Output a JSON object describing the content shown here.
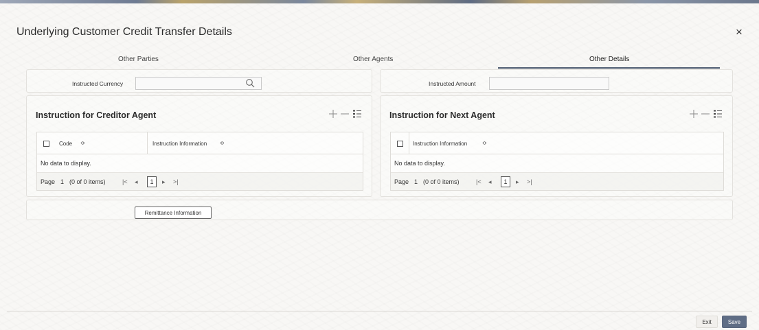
{
  "dialog": {
    "title": "Underlying Customer Credit Transfer Details",
    "close_symbol": "×"
  },
  "tabs": [
    {
      "label": "Other Parties",
      "active": false
    },
    {
      "label": "Other Agents",
      "active": false
    },
    {
      "label": "Other Details",
      "active": true
    }
  ],
  "fields": {
    "instructed_currency_label": "Instructed Currency",
    "instructed_currency_value": "",
    "instructed_amount_label": "Instructed Amount",
    "instructed_amount_value": ""
  },
  "creditor_agent": {
    "title": "Instruction for Creditor Agent",
    "columns": [
      "Code",
      "Instruction Information"
    ],
    "no_data": "No data to display.",
    "pager": {
      "page_label": "Page",
      "page_number": "1",
      "items": "(0 of 0 items)",
      "current": "1"
    }
  },
  "next_agent": {
    "title": "Instruction for Next Agent",
    "columns": [
      "Instruction Information"
    ],
    "no_data": "No data to display.",
    "pager": {
      "page_label": "Page",
      "page_number": "1",
      "items": "(0 of 0 items)",
      "current": "1"
    }
  },
  "buttons": {
    "remittance": "Remittance Information",
    "exit": "Exit",
    "save": "Save"
  },
  "symbols": {
    "add": "+",
    "remove": "−",
    "sort": "≎",
    "first": "|<",
    "prev": "◂",
    "next": "▸",
    "last": ">|"
  },
  "colors": {
    "accent": "#4d5b70",
    "save_button": "#5f6d85"
  }
}
